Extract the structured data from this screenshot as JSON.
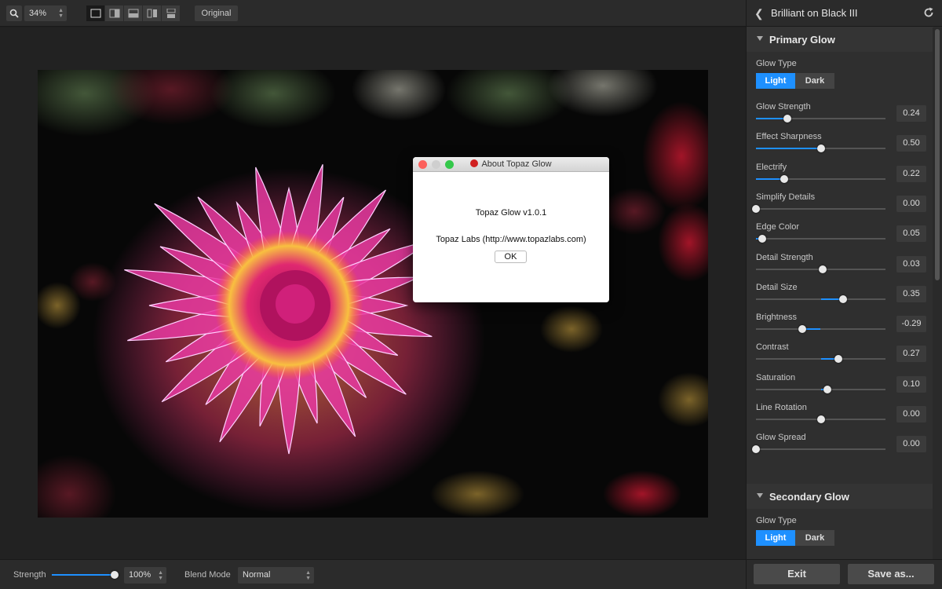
{
  "toolbar": {
    "zoom_value": "34%",
    "original_label": "Original"
  },
  "dialog": {
    "title": "About Topaz Glow",
    "version_text": "Topaz Glow v1.0.1",
    "company_text": "Topaz Labs (http://www.topazlabs.com)",
    "ok_label": "OK"
  },
  "bottom": {
    "strength_label": "Strength",
    "strength_value": "100%",
    "strength_fraction": 1.0,
    "blend_label": "Blend Mode",
    "blend_value": "Normal",
    "exit_label": "Exit",
    "save_label": "Save as..."
  },
  "panel": {
    "preset_title": "Brilliant on Black III",
    "primary": {
      "title": "Primary Glow",
      "glow_type_label": "Glow Type",
      "light_label": "Light",
      "dark_label": "Dark",
      "selected": "Light",
      "params": [
        {
          "label": "Glow Strength",
          "value": "0.24"
        },
        {
          "label": "Effect Sharpness",
          "value": "0.50"
        },
        {
          "label": "Electrify",
          "value": "0.22"
        },
        {
          "label": "Simplify Details",
          "value": "0.00"
        },
        {
          "label": "Edge Color",
          "value": "0.05"
        },
        {
          "label": "Detail Strength",
          "value": "0.03"
        },
        {
          "label": "Detail Size",
          "value": "0.35"
        },
        {
          "label": "Brightness",
          "value": "-0.29"
        },
        {
          "label": "Contrast",
          "value": "0.27"
        },
        {
          "label": "Saturation",
          "value": "0.10"
        },
        {
          "label": "Line Rotation",
          "value": "0.00"
        },
        {
          "label": "Glow Spread",
          "value": "0.00"
        }
      ]
    },
    "secondary": {
      "title": "Secondary Glow",
      "glow_type_label": "Glow Type",
      "light_label": "Light",
      "dark_label": "Dark",
      "selected": "Light"
    }
  },
  "colors": {
    "accent": "#1e90ff"
  }
}
